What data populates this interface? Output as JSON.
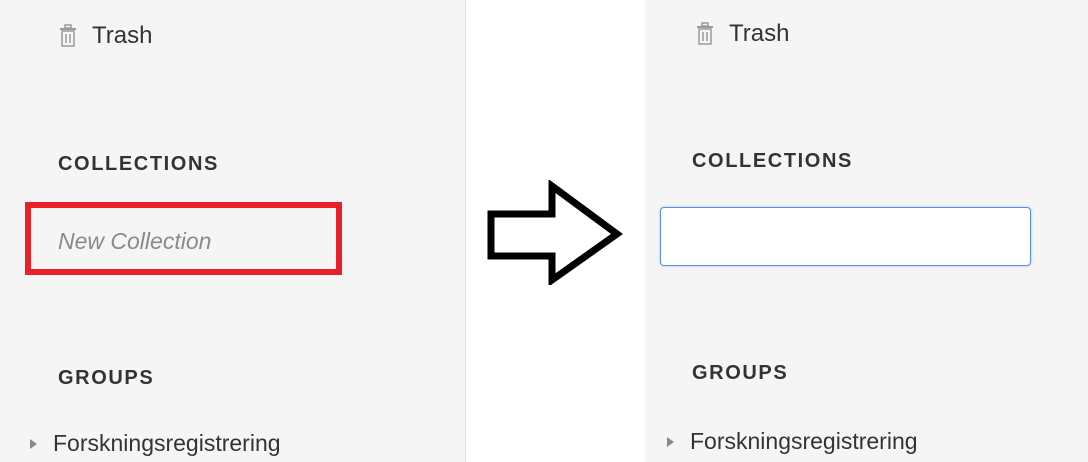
{
  "left_panel": {
    "trash_label": "Trash",
    "collections_heading": "COLLECTIONS",
    "new_collection_placeholder": "New Collection",
    "groups_heading": "GROUPS",
    "group_name": "Forskningsregistrering"
  },
  "right_panel": {
    "trash_label": "Trash",
    "collections_heading": "COLLECTIONS",
    "new_collection_input_value": "",
    "groups_heading": "GROUPS",
    "group_name": "Forskningsregistrering"
  },
  "colors": {
    "highlight": "#e8202a",
    "input_focus_border": "#5b8fd8",
    "sidebar_bg": "#f5f5f5"
  },
  "icons": {
    "trash": "trash-icon",
    "expand": "triangle-right-icon",
    "transition": "arrow-right-icon"
  }
}
